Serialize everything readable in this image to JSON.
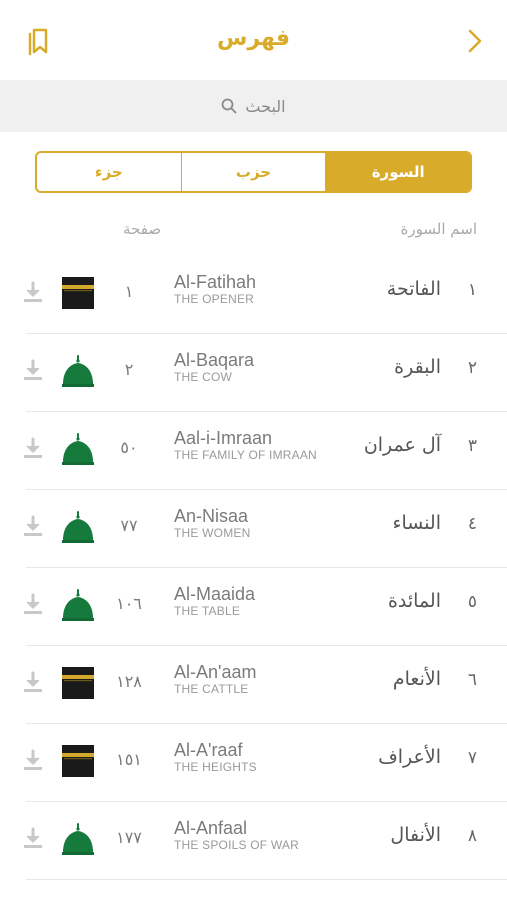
{
  "header": {
    "title": "فهرس"
  },
  "search": {
    "placeholder": "البحث"
  },
  "tabs": [
    {
      "label": "جزء",
      "active": false
    },
    {
      "label": "حزب",
      "active": false
    },
    {
      "label": "السورة",
      "active": true
    }
  ],
  "columns": {
    "name": "اسم السورة",
    "page": "صفحة"
  },
  "colors": {
    "accent": "#d9ab2a",
    "medina": "#157a3c",
    "kaaba": "#1a1a1a"
  },
  "surahs": [
    {
      "num": "١",
      "ar": "الفاتحة",
      "en": "Al-Fatihah",
      "meaning": "THE OPENER",
      "page": "١",
      "place": "kaaba-icon"
    },
    {
      "num": "٢",
      "ar": "البقرة",
      "en": "Al-Baqara",
      "meaning": "THE COW",
      "page": "٢",
      "place": "medina-dome-icon"
    },
    {
      "num": "٣",
      "ar": "آل عمران",
      "en": "Aal-i-Imraan",
      "meaning": "THE FAMILY OF IMRAAN",
      "page": "٥٠",
      "place": "medina-dome-icon"
    },
    {
      "num": "٤",
      "ar": "النساء",
      "en": "An-Nisaa",
      "meaning": "THE WOMEN",
      "page": "٧٧",
      "place": "medina-dome-icon"
    },
    {
      "num": "٥",
      "ar": "المائدة",
      "en": "Al-Maaida",
      "meaning": "THE TABLE",
      "page": "١٠٦",
      "place": "medina-dome-icon"
    },
    {
      "num": "٦",
      "ar": "الأنعام",
      "en": "Al-An'aam",
      "meaning": "THE CATTLE",
      "page": "١٢٨",
      "place": "kaaba-icon"
    },
    {
      "num": "٧",
      "ar": "الأعراف",
      "en": "Al-A'raaf",
      "meaning": "THE HEIGHTS",
      "page": "١٥١",
      "place": "kaaba-icon"
    },
    {
      "num": "٨",
      "ar": "الأنفال",
      "en": "Al-Anfaal",
      "meaning": "THE SPOILS OF WAR",
      "page": "١٧٧",
      "place": "medina-dome-icon"
    }
  ]
}
